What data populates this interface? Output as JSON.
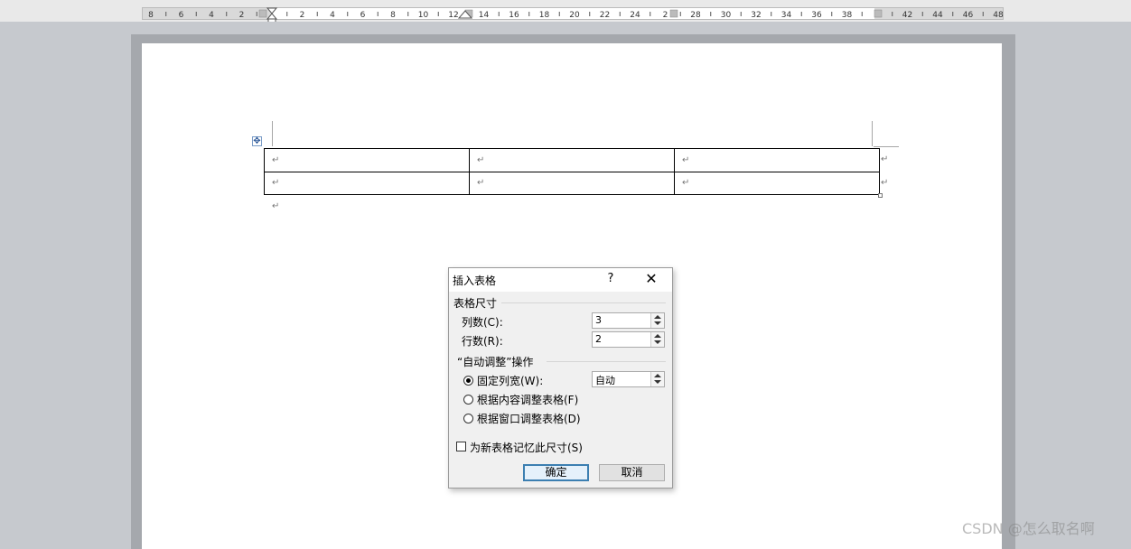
{
  "ruler": {
    "left_labels": [
      "8",
      "6",
      "4",
      "2"
    ],
    "right_labels": [
      "2",
      "4",
      "6",
      "8",
      "10",
      "12",
      "14",
      "16",
      "18",
      "20",
      "22",
      "24",
      "2",
      "28",
      "30",
      "32",
      "34",
      "36",
      "38",
      "42",
      "44",
      "46",
      "48"
    ]
  },
  "document": {
    "paragraph_mark": "↵",
    "table_move_handle": "✥",
    "table": {
      "columns": 3,
      "rows": [
        [
          "↵",
          "↵",
          "↵"
        ],
        [
          "↵",
          "↵",
          "↵"
        ]
      ],
      "row_end_marks": [
        "↵",
        "↵"
      ]
    },
    "after_table_mark": "↵"
  },
  "dialog": {
    "title": "插入表格",
    "help": "?",
    "close": "✕",
    "size_group": "表格尺寸",
    "columns_label": "列数(C):",
    "columns_value": "3",
    "rows_label": "行数(R):",
    "rows_value": "2",
    "autofit_group": "“自动调整”操作",
    "fixed_width_label": "固定列宽(W):",
    "fixed_width_value": "自动",
    "autofit_content_label": "根据内容调整表格(F)",
    "autofit_window_label": "根据窗口调整表格(D)",
    "selected_option": "fixed_width",
    "remember_label": "为新表格记忆此尺寸(S)",
    "remember_checked": false,
    "ok_label": "确定",
    "cancel_label": "取消"
  },
  "watermark": "CSDN @怎么取名啊",
  "colors": {
    "ruler_background": "#e9e9e9",
    "workspace": "#c6c9ce",
    "page_shadow": "#a5a8ad",
    "default_button_border": "#3c7fb1"
  }
}
